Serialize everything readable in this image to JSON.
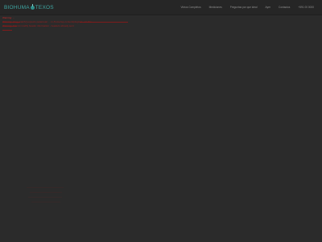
{
  "brand": {
    "logo_text_left": "BIOHUMA",
    "logo_text_right": "TEXOS",
    "accent_color": "#3fa7a3",
    "logo_icon": "leaf-drop-icon"
  },
  "nav": {
    "items": [
      {
        "label": "Vidros Completos"
      },
      {
        "label": "Mediciones"
      },
      {
        "label": "Preguntas por que ideal"
      },
      {
        "label": "Ayer"
      },
      {
        "label": "Contactos"
      },
      {
        "label": "+591 00 0000"
      }
    ]
  },
  "content": {
    "lines": [
      {
        "text": "Warning: ..."
      },
      {
        "text": "Warning: preg_match() expects parameter ... in /home/wp-content/plugins/... on line ..."
      },
      {
        "text": "Warning: Cannot modify header information - headers already sent"
      },
      {
        "text": "..."
      }
    ]
  },
  "colors": {
    "background": "#2b2b2b",
    "header_background": "#262626",
    "error_text": "#a11d1d"
  }
}
